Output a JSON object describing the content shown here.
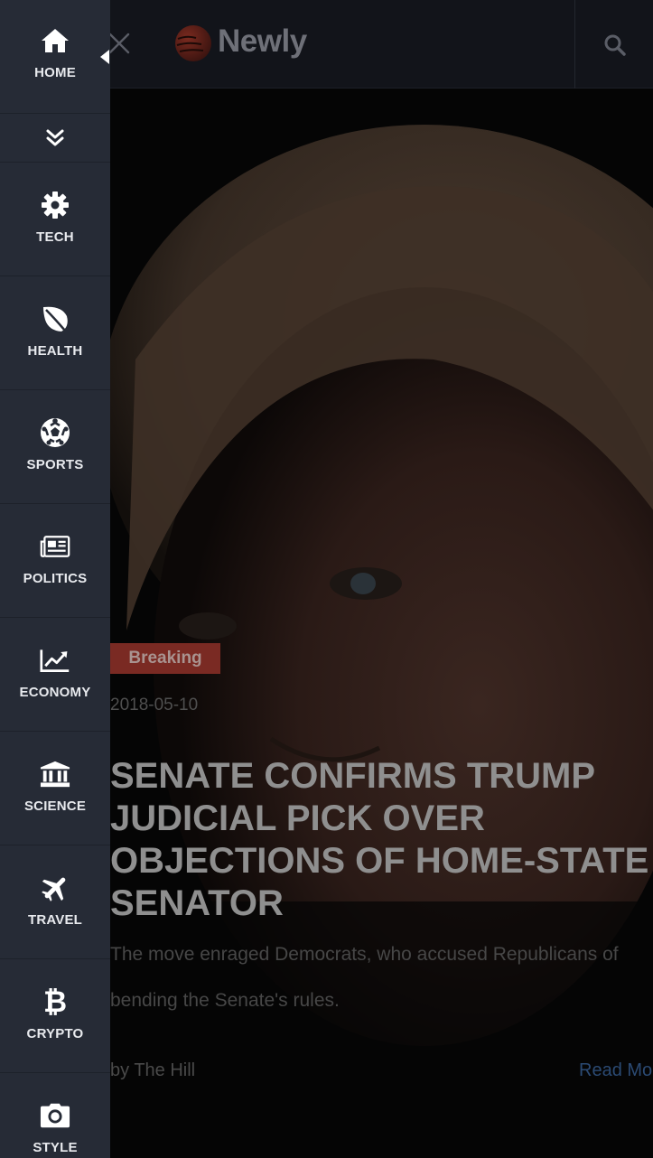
{
  "header": {
    "brand": "Newly",
    "icons": [
      "close-icon",
      "newly-logo",
      "search-icon"
    ]
  },
  "sidebar": {
    "items": [
      {
        "label": "HOME",
        "icon": "home-icon"
      },
      {
        "label": "TECH",
        "icon": "gear-icon"
      },
      {
        "label": "HEALTH",
        "icon": "leaf-icon"
      },
      {
        "label": "SPORTS",
        "icon": "soccer-ball-icon"
      },
      {
        "label": "POLITICS",
        "icon": "newspaper-icon"
      },
      {
        "label": "ECONOMY",
        "icon": "chart-line-icon"
      },
      {
        "label": "SCIENCE",
        "icon": "institution-icon"
      },
      {
        "label": "TRAVEL",
        "icon": "plane-icon"
      },
      {
        "label": "CRYPTO",
        "icon": "bitcoin-icon"
      },
      {
        "label": "STYLE",
        "icon": "camera-icon"
      }
    ],
    "collapse_icon": "chevrons-down-icon"
  },
  "article": {
    "badge": "Breaking",
    "date": "2018-05-10",
    "headline_lines": [
      "SENATE CONFIRMS TRUMP",
      "JUDICIAL PICK OVER",
      "OBJECTIONS OF HOME-STATE",
      "SENATOR"
    ],
    "summary_lines": [
      "The move enraged Democrats, who accused Republicans of",
      "bending the Senate's rules."
    ],
    "byline": "by The Hill",
    "read_more": "Read More"
  },
  "colors": {
    "sidebar_bg": "#262b36",
    "topbar_bg": "#12141a",
    "badge_bg": "#7a2a23",
    "link": "#2b4a73"
  }
}
